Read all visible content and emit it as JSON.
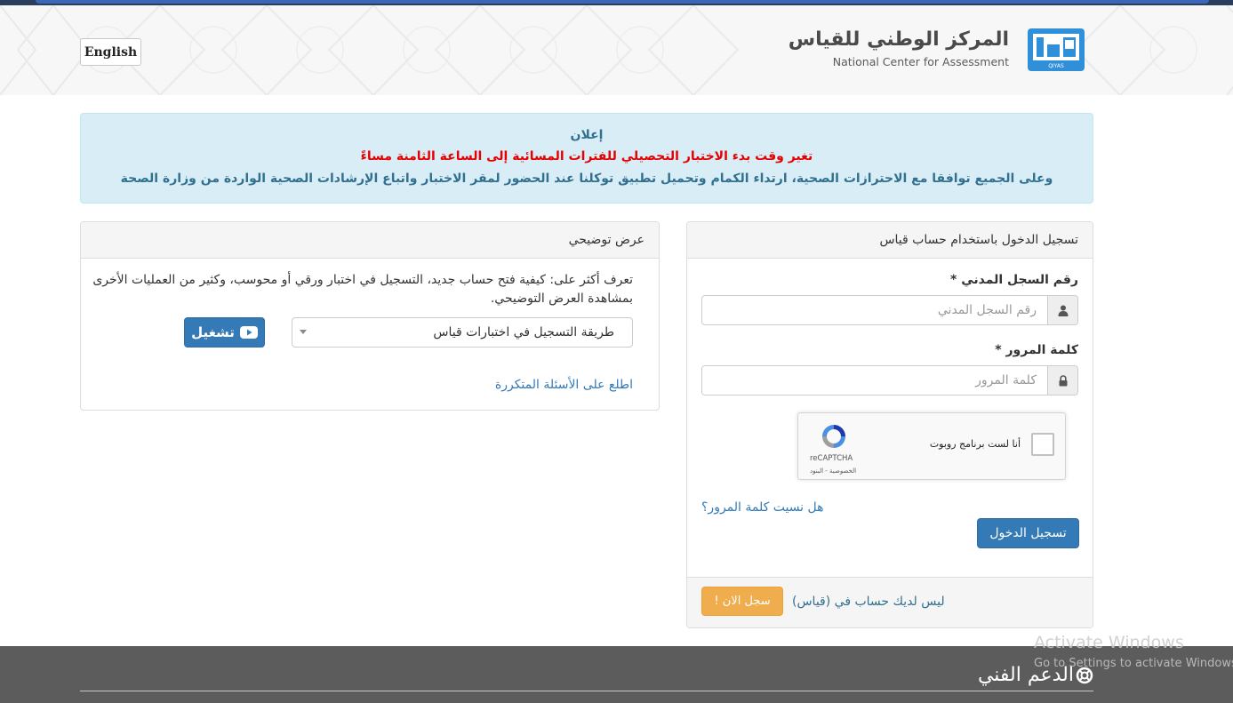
{
  "header": {
    "language_button": "English",
    "logo": {
      "title_ar": "المركز الوطني للقياس",
      "title_en": "National Center for Assessment",
      "mark_caption": "QIYAS"
    }
  },
  "announcement": {
    "heading": "إعلان",
    "highlight": "تغير وقت بدء الاختبار التحصيلي للفترات المسائية إلى الساعة الثامنة مساءً",
    "body": "وعلى الجميع توافقا مع الاحترازات الصحية، ارتداء الكمام وتحميل تطبيق توكلنا عند الحضور لمقر الاختبار واتباع الإرشادات الصحية الواردة من وزارة الصحة"
  },
  "login": {
    "title": "تسجيل الدخول باستخدام حساب قياس",
    "id_label": "رقم السجل المدني *",
    "id_placeholder": "رقم السجل المدني",
    "password_label": "كلمة المرور *",
    "password_placeholder": "كلمة المرور",
    "recaptcha": {
      "checkbox_label": "أنا لست برنامج روبوت",
      "brand": "reCAPTCHA",
      "links": "الخصوصية - البنود"
    },
    "forgot_password": "هل نسيت كلمة المرور؟",
    "submit_button": "تسجيل الدخول",
    "no_account_text": "ليس لديك حساب في (قياس)",
    "register_button": "سجل الان !"
  },
  "demo": {
    "title": "عرض توضيحي",
    "description": "تعرف أكثر على: كيفية فتح حساب جديد، التسجيل في اختبار ورقي أو محوسب، وكثير من العمليات الأخرى بمشاهدة العرض التوضيحي.",
    "selected_video": "طريقة التسجيل في اختبارات قياس",
    "play_button": "تشغيل",
    "faq_link": "اطلع على الأسئلة المتكررة"
  },
  "footer": {
    "support_title": "الدعم الفني"
  },
  "watermark": {
    "line1": "Activate Windows",
    "line2": "Go to Settings to activate Windows."
  },
  "colors": {
    "primary": "#337ab7",
    "warning": "#f0ad4e",
    "alert_bg": "#d9edf7",
    "alert_text": "#31708f",
    "alert_highlight": "#e60000",
    "footer_bg": "#5c5c5c",
    "logo_blue": "#2f8fd8"
  },
  "icons": {
    "id_field": "user-icon",
    "password_field": "lock-icon",
    "play_button": "youtube-play-icon",
    "support": "life-ring-icon"
  }
}
